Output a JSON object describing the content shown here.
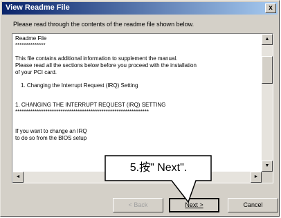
{
  "window": {
    "title": "View Readme File",
    "close_glyph": "x"
  },
  "instruction": "Please read through the contents of the readme file shown below.",
  "readme": {
    "lines": [
      "Readme File",
      "**************",
      "",
      "This file contains additional information to supplement the manual.",
      "Please read all the sections below before you proceed with the installation",
      "of your PCI card.",
      "",
      "1.   Changing the Interrupt Request (IRQ) Setting",
      "",
      "1.  CHANGING THE INTERRUPT REQUEST (IRQ) SETTING",
      "**************************************************************",
      "",
      "If you want to change an IRQ",
      "to do so from the BIOS setup"
    ]
  },
  "scrollbar": {
    "up_icon": "▲",
    "down_icon": "▼",
    "left_icon": "◄",
    "right_icon": "►"
  },
  "buttons": {
    "back": "< Back",
    "next": "Next >",
    "cancel": "Cancel"
  },
  "callout": {
    "text": "5.按\" Next\"."
  }
}
